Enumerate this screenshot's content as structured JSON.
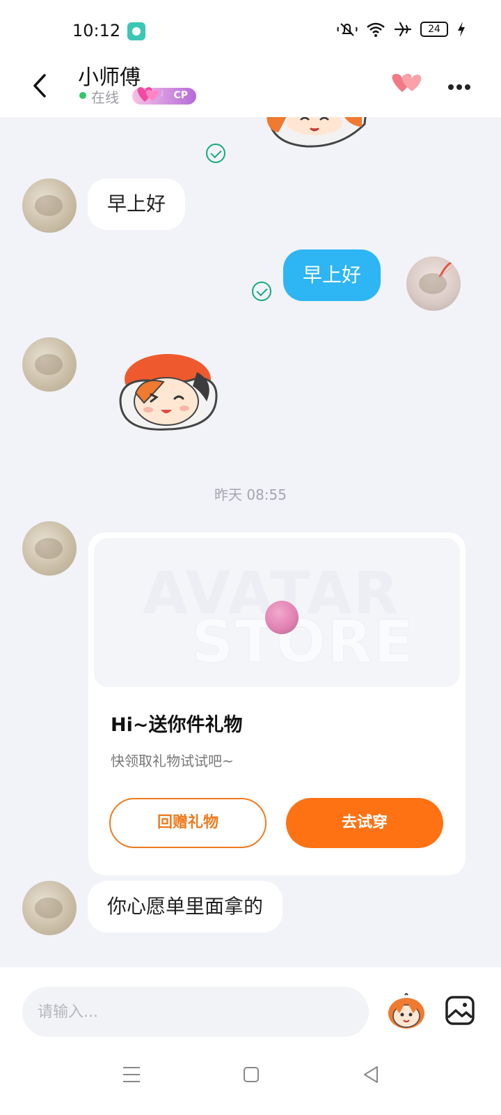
{
  "status_bar": {
    "time": "10:12",
    "battery": "24",
    "icons": [
      "app-notification-icon",
      "mute-icon",
      "wifi-icon",
      "airplane-icon",
      "battery-icon",
      "charging-icon"
    ]
  },
  "header": {
    "contact_name": "小师傅",
    "status": "在线",
    "cp_badge": "CP",
    "icons": [
      "back-icon",
      "hearts-icon",
      "more-icon"
    ]
  },
  "messages": [
    {
      "side": "left",
      "text": "早上好"
    },
    {
      "side": "right",
      "text": "早上好"
    },
    {
      "side": "left",
      "type": "sticker"
    }
  ],
  "timestamp": "昨天 08:55",
  "gift_card": {
    "banner_line1": "AVATAR",
    "banner_line2": "STORE",
    "title": "Hi~送你件礼物",
    "subtitle": "快领取礼物试试吧~",
    "return_gift_label": "回赠礼物",
    "try_on_label": "去试穿"
  },
  "last_message": "你心愿单里面拿的",
  "input": {
    "placeholder": "请输入..."
  },
  "colors": {
    "accent_blue": "#2db5f4",
    "accent_orange": "#ff7214",
    "read_check": "#17a97a",
    "online_green": "#35c46a"
  }
}
